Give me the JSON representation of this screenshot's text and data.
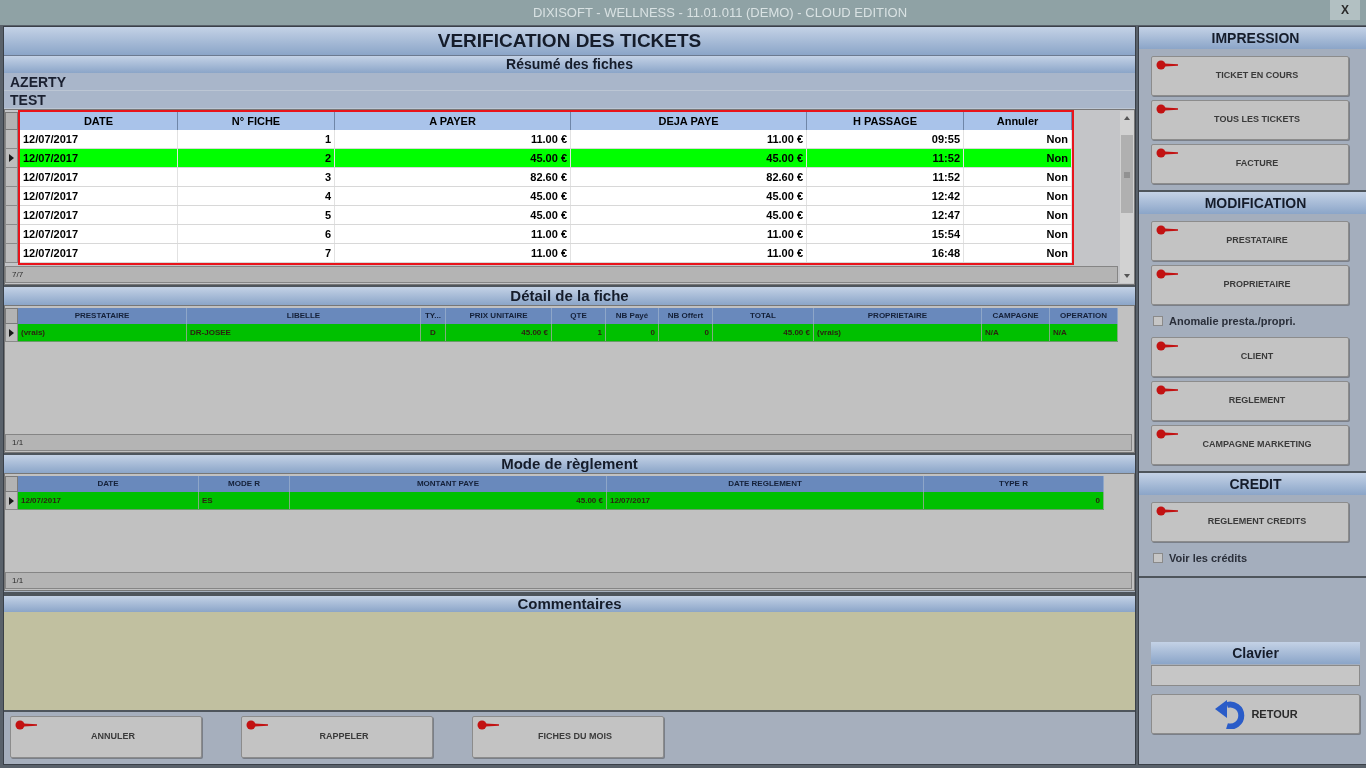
{
  "window": {
    "title": "DIXISOFT -  WELLNESS - 11.01.011 (DEMO) - CLOUD EDITION",
    "close": "X"
  },
  "main": {
    "title": "VERIFICATION DES TICKETS"
  },
  "summary": {
    "title": "Résumé des fiches",
    "info_lines": [
      "AZERTY",
      "TEST"
    ],
    "table": {
      "columns": [
        "DATE",
        "N° FICHE",
        "A PAYER",
        "DEJA PAYE",
        "H PASSAGE",
        "Annuler"
      ],
      "rows": [
        {
          "cells": [
            "12/07/2017",
            "1",
            "11.00 €",
            "11.00 €",
            "09:55",
            "Non"
          ],
          "selected": false
        },
        {
          "cells": [
            "12/07/2017",
            "2",
            "45.00 €",
            "45.00 €",
            "11:52",
            "Non"
          ],
          "selected": true
        },
        {
          "cells": [
            "12/07/2017",
            "3",
            "82.60 €",
            "82.60 €",
            "11:52",
            "Non"
          ],
          "selected": false
        },
        {
          "cells": [
            "12/07/2017",
            "4",
            "45.00 €",
            "45.00 €",
            "12:42",
            "Non"
          ],
          "selected": false
        },
        {
          "cells": [
            "12/07/2017",
            "5",
            "45.00 €",
            "45.00 €",
            "12:47",
            "Non"
          ],
          "selected": false
        },
        {
          "cells": [
            "12/07/2017",
            "6",
            "11.00 €",
            "11.00 €",
            "15:54",
            "Non"
          ],
          "selected": false
        },
        {
          "cells": [
            "12/07/2017",
            "7",
            "11.00 €",
            "11.00 €",
            "16:48",
            "Non"
          ],
          "selected": false
        }
      ],
      "footer": "7/7"
    }
  },
  "detail": {
    "title": "Détail de la fiche",
    "table": {
      "columns": [
        "PRESTATAIRE",
        "LIBELLE",
        "TY...",
        "PRIX UNITAIRE",
        "QTE",
        "NB Payé",
        "NB Offert",
        "TOTAL",
        "PROPRIETAIRE",
        "CAMPAGNE",
        "OPERATION"
      ],
      "rows": [
        {
          "cells": [
            "(vrais)",
            "DR-JOSEE",
            "D",
            "45.00 €",
            "1",
            "0",
            "0",
            "45.00 €",
            "(vrais)",
            "N/A",
            "N/A"
          ],
          "selected": true
        }
      ],
      "footer": "1/1"
    }
  },
  "payment": {
    "title": "Mode de règlement",
    "table": {
      "columns": [
        "DATE",
        "MODE R",
        "MONTANT PAYE",
        "DATE REGLEMENT",
        "TYPE R"
      ],
      "rows": [
        {
          "cells": [
            "12/07/2017",
            "ES",
            "45.00 €",
            "12/07/2017",
            "0"
          ],
          "selected": true
        }
      ],
      "footer": "1/1"
    }
  },
  "comments": {
    "title": "Commentaires"
  },
  "bottom_buttons": [
    "ANNULER",
    "RAPPELER",
    "FICHES DU MOIS"
  ],
  "sidebar": {
    "sections": [
      {
        "title": "IMPRESSION",
        "items": [
          {
            "kind": "button",
            "label": "TICKET EN COURS"
          },
          {
            "kind": "button",
            "label": "TOUS LES TICKETS"
          },
          {
            "kind": "button",
            "label": "FACTURE"
          }
        ]
      },
      {
        "title": "MODIFICATION",
        "items": [
          {
            "kind": "button",
            "label": "PRESTATAIRE"
          },
          {
            "kind": "button",
            "label": "PROPRIETAIRE"
          },
          {
            "kind": "checkbox",
            "label": "Anomalie presta./propri.",
            "checked": false
          },
          {
            "kind": "button",
            "label": "CLIENT"
          },
          {
            "kind": "button",
            "label": "REGLEMENT"
          },
          {
            "kind": "button",
            "label": "CAMPAGNE MARKETING"
          }
        ]
      },
      {
        "title": "CREDIT",
        "items": [
          {
            "kind": "button",
            "label": "REGLEMENT CREDITS"
          },
          {
            "kind": "checkbox",
            "label": "Voir les crédits",
            "checked": false
          }
        ]
      }
    ],
    "keyboard": {
      "title": "Clavier"
    },
    "back_button": "RETOUR"
  }
}
